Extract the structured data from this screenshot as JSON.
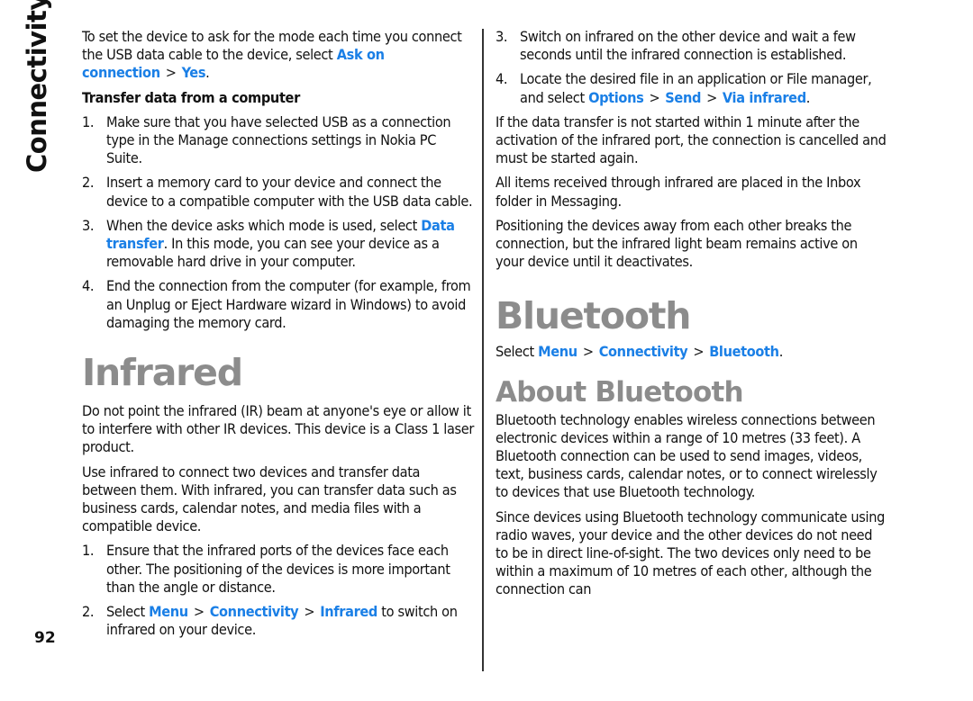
{
  "side_title": "Connectivity",
  "page_number": "92",
  "colors": {
    "link": "#1a7fe6",
    "heading": "#8c8c8c",
    "text": "#111111"
  },
  "left": {
    "intro": {
      "text_before": "To set the device to ask for the mode each time you connect the USB data cable to the device, select ",
      "link1": "Ask on connection",
      "sep": ">",
      "link2": "Yes",
      "text_after": "."
    },
    "transfer_heading": "Transfer data from a computer",
    "transfer_steps": [
      {
        "num": "1.",
        "text": "Make sure that you have selected USB as a connection type in the Manage connections settings in Nokia PC Suite."
      },
      {
        "num": "2.",
        "text": "Insert a memory card to your device and connect the device to a compatible computer with the USB data cable."
      },
      {
        "num": "3.",
        "text_before": "When the device asks which mode is used, select ",
        "link": "Data transfer",
        "text_after": ". In this mode, you can see your device as a removable hard drive in your computer."
      },
      {
        "num": "4.",
        "text": "End the connection from the computer (for example, from an Unplug or Eject Hardware wizard in Windows) to avoid damaging the memory card."
      }
    ],
    "infrared_heading": "Infrared",
    "infrared_warning": "Do not point the infrared (IR) beam at anyone's eye or allow it to interfere with other IR devices. This device is a Class 1 laser product.",
    "infrared_intro": "Use infrared to connect two devices and transfer data between them. With infrared, you can transfer data such as business cards, calendar notes, and media files with a compatible device.",
    "infrared_steps": [
      {
        "num": "1.",
        "text": "Ensure that the infrared ports of the devices face each other. The positioning of the devices is more important than the angle or distance."
      },
      {
        "num": "2.",
        "text_before": "Select ",
        "link1": "Menu",
        "sep1": ">",
        "link2": "Connectivity",
        "sep2": ">",
        "link3": "Infrared",
        "text_after": " to switch on infrared on your device."
      }
    ]
  },
  "right": {
    "infrared_steps": [
      {
        "num": "3.",
        "text": "Switch on infrared on the other device and wait a few seconds until the infrared connection is established."
      },
      {
        "num": "4.",
        "text_before": "Locate the desired file in an application or File manager, and select ",
        "link1": "Options",
        "sep1": ">",
        "link2": "Send",
        "sep2": ">",
        "link3": "Via infrared",
        "text_after": "."
      }
    ],
    "timeout_note": "If the data transfer is not started within 1 minute after the activation of the infrared port, the connection is cancelled and must be started again.",
    "inbox_note": "All items received through infrared are placed in the Inbox folder in Messaging.",
    "positioning_note": "Positioning the devices away from each other breaks the connection, but the infrared light beam remains active on your device until it deactivates.",
    "bluetooth_heading": "Bluetooth",
    "bluetooth_select": {
      "text_before": "Select ",
      "link1": "Menu",
      "sep1": ">",
      "link2": "Connectivity",
      "sep2": ">",
      "link3": "Bluetooth",
      "text_after": "."
    },
    "about_heading": "About Bluetooth",
    "about_p1": "Bluetooth technology enables wireless connections between electronic devices within a range of 10 metres (33 feet). A Bluetooth connection can be used to send images, videos, text, business cards, calendar notes, or to connect wirelessly to devices that use Bluetooth technology.",
    "about_p2": "Since devices using Bluetooth technology communicate using radio waves, your device and the other devices do not need to be in direct line-of-sight. The two devices only need to be within a maximum of 10 metres of each other, although the connection can"
  }
}
